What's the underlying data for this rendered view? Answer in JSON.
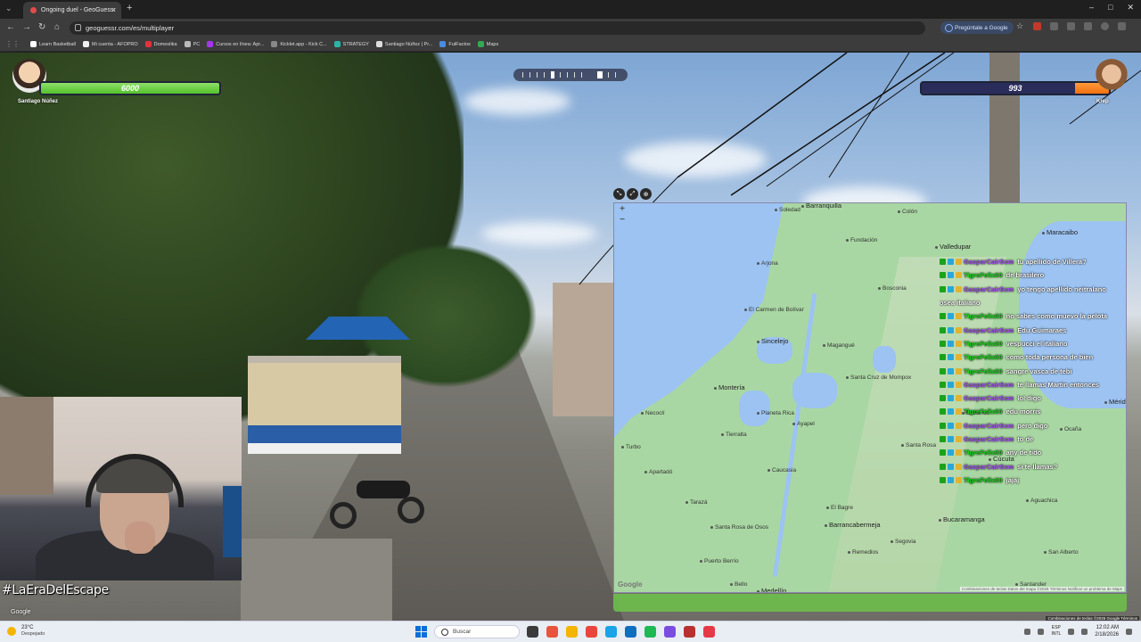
{
  "browser": {
    "tab_title": "Ongoing duel - GeoGuessr",
    "new_tab": "+",
    "tab_close": "×",
    "url": "geoguessr.com/es/multiplayer",
    "ask_google": "Pregúntale a Google",
    "nav": {
      "back": "←",
      "forward": "→",
      "reload": "↻",
      "home": "⌂"
    },
    "window": {
      "minimize": "–",
      "maximize": "□",
      "close": "✕"
    }
  },
  "bookmarks": [
    {
      "label": "Learn Basketball",
      "color": "#ffffff"
    },
    {
      "label": "Mi cuenta - AFOPRO",
      "color": "#f0f0f0"
    },
    {
      "label": "Domestika",
      "color": "#e2333b"
    },
    {
      "label": "PC",
      "color": "#bbbbbb"
    },
    {
      "label": "Cursos en línea: Apr...",
      "color": "#a435f0"
    },
    {
      "label": "Kicklet.app - Kick C...",
      "color": "#888888"
    },
    {
      "label": "STRATEGY",
      "color": "#29b6a8"
    },
    {
      "label": "Santiago Núñez | Pr...",
      "color": "#dddddd"
    },
    {
      "label": "FutFactos",
      "color": "#4a8be0"
    },
    {
      "label": "Maps",
      "color": "#34a853"
    }
  ],
  "game": {
    "player1": {
      "name": "Santiago Núñez",
      "health": "6000",
      "health_fraction": 1.0
    },
    "player2": {
      "name": "Krep",
      "health": "993",
      "health_fraction": 0.18
    },
    "map_labels": {
      "cities": [
        "Soledad",
        "Barranquilla",
        "Maracaibo",
        "Valledupar",
        "Fundación",
        "Arjona",
        "El Carmen de Bolívar",
        "Sincelejo",
        "Montería",
        "Bosconia",
        "Magangué",
        "Santa Cruz de Mompox",
        "El Banco",
        "Cúcuta",
        "Planeta Rica",
        "Caucasia",
        "Tierralta",
        "Santa Rosa",
        "El Bagre",
        "Barrancabermeja",
        "Bucaramanga",
        "Mérida",
        "Necoclí",
        "Turbo",
        "Apartadó",
        "Segovia",
        "Remedios",
        "Santa Rosa de Osos",
        "Bello",
        "Medellín",
        "Colón",
        "Tarazá",
        "Ocaña",
        "Aguachica",
        "San Alberto",
        "Santander",
        "Ayapel",
        "Puerto Berrío"
      ],
      "zoom_in": "+",
      "zoom_out": "−",
      "google_logo": "Google",
      "footer": "Combinaciones de teclas   Datos del mapa ©2026   Términos   Notificar un problema de Maps"
    },
    "map_controls": [
      "⤡",
      "⤢",
      "⊕"
    ]
  },
  "chat": [
    {
      "user": "GasparCairScm",
      "msg": "tu apellido de Villera?",
      "color": "#b05cff"
    },
    {
      "user": "TigreFelix00",
      "msg": "de brasilero",
      "color": "#1ed91e"
    },
    {
      "user": "GasparCairScm",
      "msg": "yo tengo apellido neitralano",
      "color": "#b05cff"
    },
    {
      "user": "",
      "msg": "osea italiano",
      "color": "#ffffff"
    },
    {
      "user": "TigreFelix00",
      "msg": "no sabes como muevo la pelota",
      "color": "#1ed91e"
    },
    {
      "user": "GasparCairScm",
      "msg": "Edu Guimaraes",
      "color": "#b05cff"
    },
    {
      "user": "TigreFelix00",
      "msg": "vespucci el italiano",
      "color": "#1ed91e"
    },
    {
      "user": "TigreFelix00",
      "msg": "como toda persona de bien",
      "color": "#1ed91e"
    },
    {
      "user": "TigreFelix00",
      "msg": "sangre vasca de tebi",
      "color": "#1ed91e"
    },
    {
      "user": "GasparCairScm",
      "msg": "te llamas Martin entonces",
      "color": "#b05cff"
    },
    {
      "user": "GasparCairScm",
      "msg": "lol digo",
      "color": "#b05cff"
    },
    {
      "user": "TigreFelix00",
      "msg": "edu morris",
      "color": "#1ed91e"
    },
    {
      "user": "GasparCairScm",
      "msg": "pero digo",
      "color": "#b05cff"
    },
    {
      "user": "GasparCairScm",
      "msg": "to de",
      "color": "#b05cff"
    },
    {
      "user": "TigreFelix00",
      "msg": "any de tido",
      "color": "#1ed91e"
    },
    {
      "user": "GasparCairScm",
      "msg": "si te llamas?",
      "color": "#b05cff"
    },
    {
      "user": "TigreFelix00",
      "msg": "jajaj",
      "color": "#1ed91e"
    }
  ],
  "overlay": {
    "hashtag": "#LaEraDelEscape",
    "sv_google": "Google",
    "sv_footer": "Combinaciones de teclas   ©2026 Google   Términos"
  },
  "taskbar": {
    "weather_temp": "23°C",
    "weather_cond": "Despejado",
    "search_placeholder": "Buscar",
    "lang_top": "ESP",
    "lang_bottom": "INTL",
    "time": "12:02 AM",
    "date": "2/18/2026",
    "app_colors": [
      "#3b3b3b",
      "#e8533b",
      "#f5b400",
      "#e8453c",
      "#1aa3e8",
      "#106ebe",
      "#1db954",
      "#7a4de0",
      "#b7322e",
      "#e63946"
    ]
  }
}
